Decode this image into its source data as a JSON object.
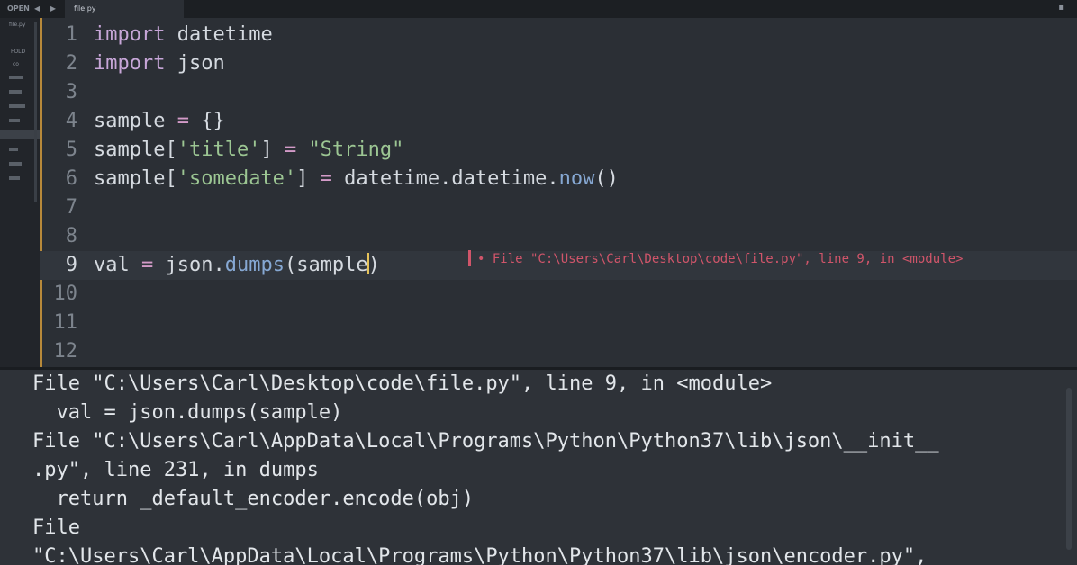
{
  "topbar": {
    "open_label": "OPEN",
    "back_arrow": "◂",
    "forward_arrow": "▸",
    "tab_label": "file.py",
    "window_control": "▪"
  },
  "sidebar": {
    "files_item": "file.py",
    "folders_label": "FOLD",
    "folder_item": "co"
  },
  "editor": {
    "lines": [
      {
        "num": "1",
        "tokens": [
          {
            "t": "import",
            "c": "kw"
          },
          {
            "t": " datetime",
            "c": ""
          }
        ]
      },
      {
        "num": "2",
        "tokens": [
          {
            "t": "import",
            "c": "kw"
          },
          {
            "t": " json",
            "c": ""
          }
        ]
      },
      {
        "num": "3",
        "tokens": []
      },
      {
        "num": "4",
        "tokens": [
          {
            "t": "sample ",
            "c": ""
          },
          {
            "t": "=",
            "c": "op"
          },
          {
            "t": " {}",
            "c": ""
          }
        ]
      },
      {
        "num": "5",
        "tokens": [
          {
            "t": "sample[",
            "c": ""
          },
          {
            "t": "'title'",
            "c": "str"
          },
          {
            "t": "] ",
            "c": ""
          },
          {
            "t": "=",
            "c": "op"
          },
          {
            "t": " ",
            "c": ""
          },
          {
            "t": "\"String\"",
            "c": "str"
          }
        ]
      },
      {
        "num": "6",
        "tokens": [
          {
            "t": "sample[",
            "c": ""
          },
          {
            "t": "'somedate'",
            "c": "str"
          },
          {
            "t": "] ",
            "c": ""
          },
          {
            "t": "=",
            "c": "op"
          },
          {
            "t": " datetime.datetime.",
            "c": ""
          },
          {
            "t": "now",
            "c": "fn"
          },
          {
            "t": "()",
            "c": ""
          }
        ]
      },
      {
        "num": "7",
        "tokens": []
      },
      {
        "num": "8",
        "tokens": []
      },
      {
        "num": "9",
        "tokens": [
          {
            "t": "val ",
            "c": ""
          },
          {
            "t": "=",
            "c": "op"
          },
          {
            "t": " json.",
            "c": ""
          },
          {
            "t": "dumps",
            "c": "fn"
          },
          {
            "t": "(sample",
            "c": ""
          },
          {
            "t": "",
            "c": "caret"
          },
          {
            "t": ")",
            "c": ""
          }
        ]
      },
      {
        "num": "10",
        "tokens": []
      },
      {
        "num": "11",
        "tokens": []
      },
      {
        "num": "12",
        "tokens": []
      }
    ],
    "current_line": "9",
    "error_message": "• File \"C:\\Users\\Carl\\Desktop\\code\\file.py\", line 9, in <module>"
  },
  "output": {
    "lines": [
      "File \"C:\\Users\\Carl\\Desktop\\code\\file.py\", line 9, in <module>",
      "  val = json.dumps(sample)",
      "File \"C:\\Users\\Carl\\AppData\\Local\\Programs\\Python\\Python37\\lib\\json\\__init__",
      ".py\", line 231, in dumps",
      "  return _default_encoder.encode(obj)",
      "File",
      "\"C:\\Users\\Carl\\AppData\\Local\\Programs\\Python\\Python37\\lib\\json\\encoder.py\","
    ]
  },
  "colors": {
    "background": "#2b2f35",
    "keyword": "#c7a6d8",
    "string": "#9cc693",
    "operator": "#d39bc8",
    "function": "#86a8d3",
    "error": "#d0556a",
    "fold_marker": "#b7893a"
  }
}
